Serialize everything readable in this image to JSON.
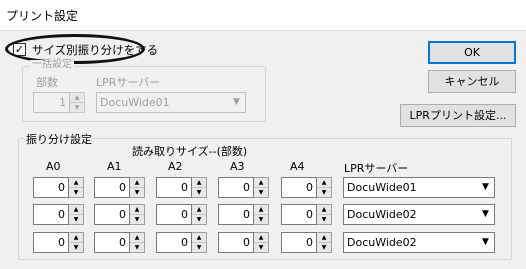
{
  "window": {
    "title": "プリント設定"
  },
  "sort_by_size": {
    "label": "サイズ別振り分けをする",
    "checked_mark": "✓"
  },
  "buttons": {
    "ok": "OK",
    "cancel": "キャンセル",
    "lpr_settings": "LPRプリント設定..."
  },
  "single": {
    "group_label": "一括設定",
    "copies_label": "部数",
    "lpr_label": "LPRサーバー",
    "copies_value": "1",
    "lpr_value": "DocuWide01"
  },
  "distribution": {
    "group_label": "振り分け設定",
    "read_size_label": "読み取りサイズ--(部数)",
    "columns": [
      "A0",
      "A1",
      "A2",
      "A3",
      "A4"
    ],
    "lpr_header": "LPRサーバー",
    "rows": [
      {
        "values": [
          "0",
          "0",
          "0",
          "0",
          "0"
        ],
        "server": "DocuWide01"
      },
      {
        "values": [
          "0",
          "0",
          "0",
          "0",
          "0"
        ],
        "server": "DocuWide02"
      },
      {
        "values": [
          "0",
          "0",
          "0",
          "0",
          "0"
        ],
        "server": "DocuWide02"
      }
    ]
  },
  "icons": {
    "spin_up": "▲",
    "spin_down": "▼",
    "dropdown": "▼"
  }
}
